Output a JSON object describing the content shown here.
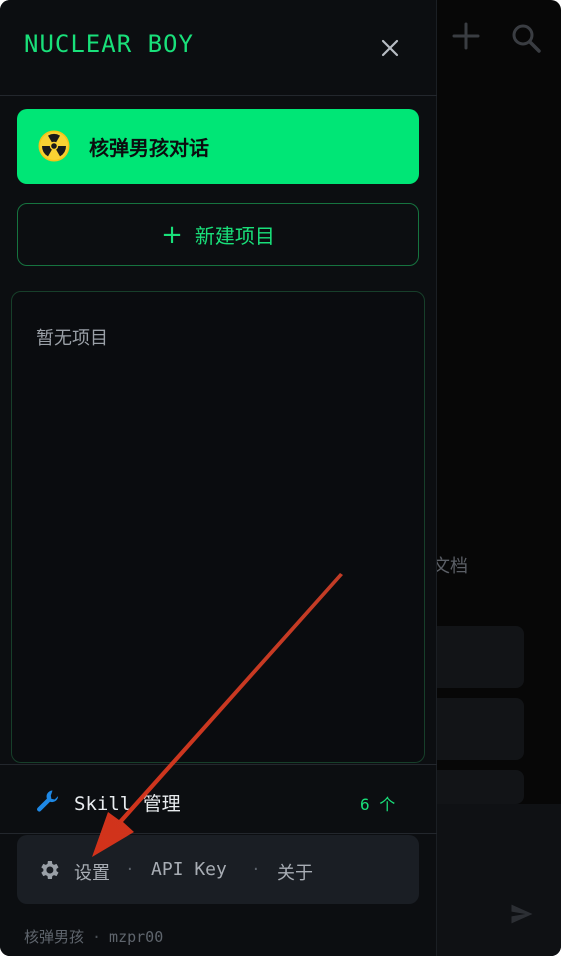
{
  "app": {
    "brand": "NUCLEAR BOY"
  },
  "background": {
    "partial_text": "文档"
  },
  "drawer": {
    "chat_button_label": "核弹男孩对话",
    "new_project_label": "新建项目",
    "projects_empty_text": "暂无项目",
    "skill": {
      "label": "Skill 管理",
      "count": "6 个"
    },
    "settings": {
      "settings_label": "设置",
      "separator": "·",
      "api_key_label": "API Key",
      "about_label": "关于"
    },
    "footer": {
      "name": "核弹男孩",
      "separator": "·",
      "handle": "mzpr00"
    }
  },
  "colors": {
    "accent": "#00e676",
    "brand_text": "#19e07a",
    "drawer_bg": "#0c0e11",
    "annotation_arrow": "#d63a1f"
  },
  "icons": {
    "close": "close-icon",
    "radioactive": "radioactive-icon",
    "plus": "plus-icon",
    "wrench": "wrench-icon",
    "gear": "gear-icon",
    "search": "search-icon",
    "send": "send-icon"
  }
}
